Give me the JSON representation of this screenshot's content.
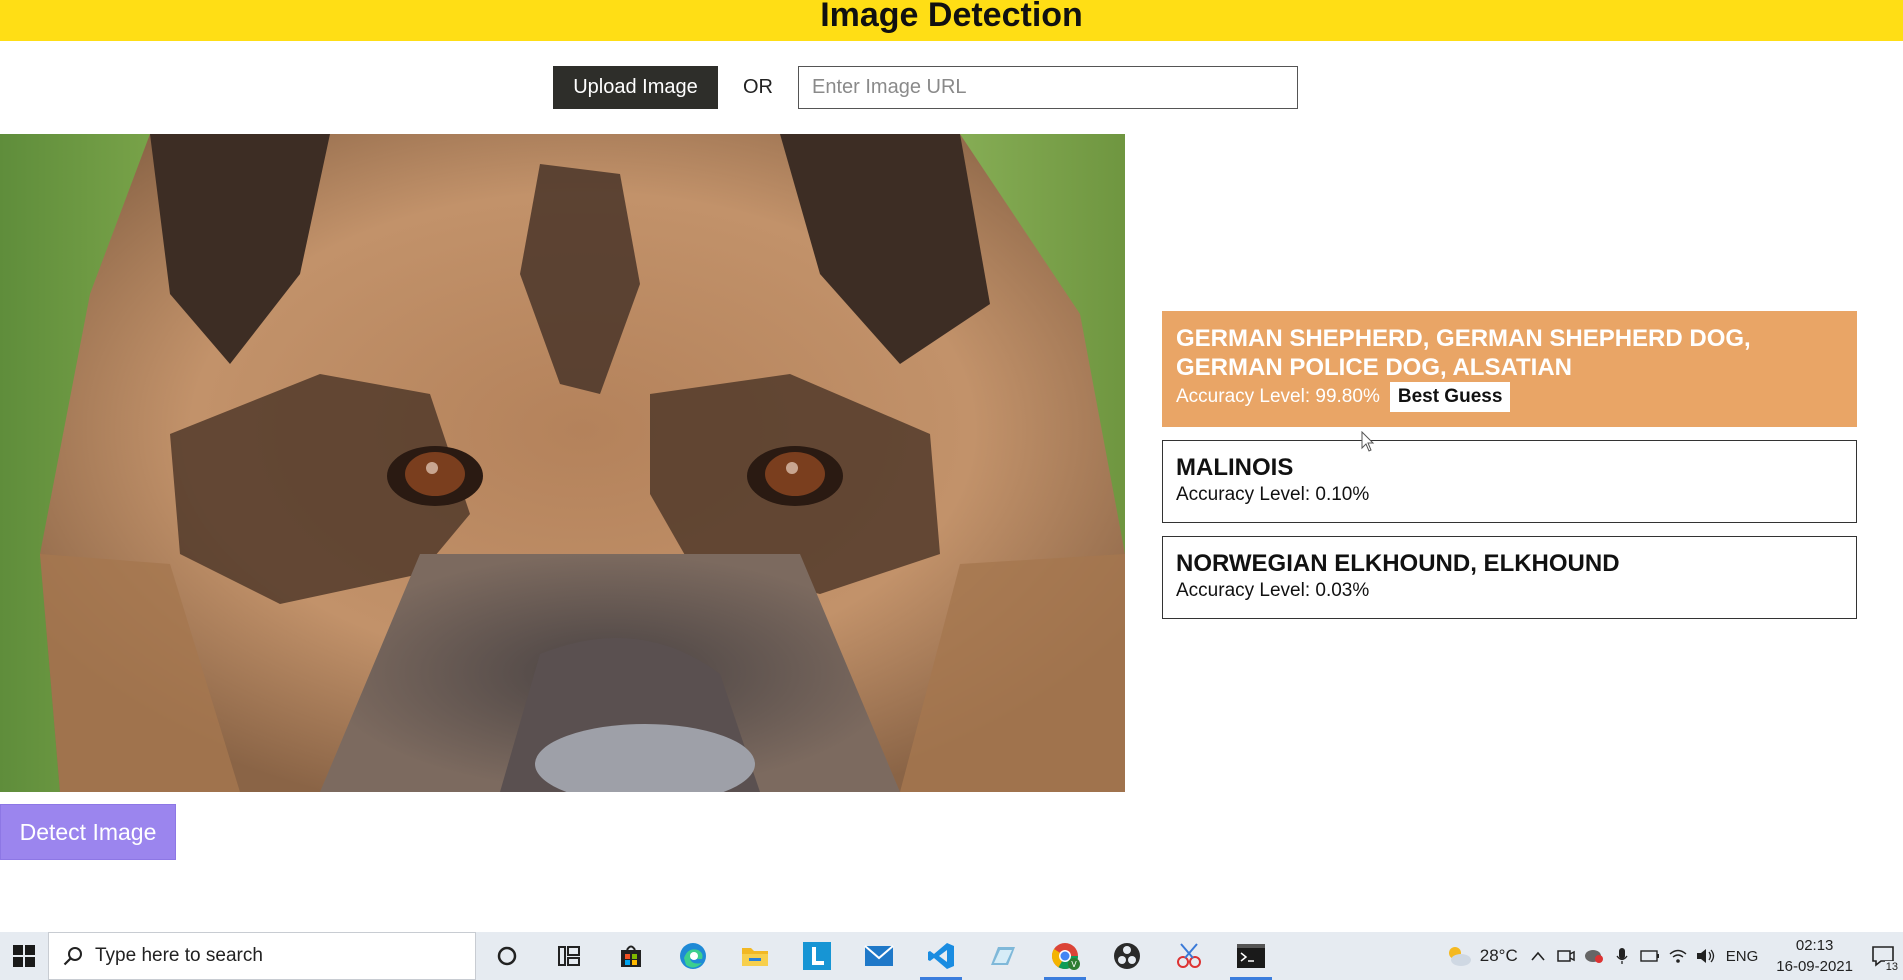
{
  "header": {
    "title": "Image Detection"
  },
  "controls": {
    "upload_label": "Upload Image",
    "or_label": "OR",
    "url_placeholder": "Enter Image URL",
    "url_value": ""
  },
  "detect_label": "Detect Image",
  "results": [
    {
      "name": "GERMAN SHEPHERD, GERMAN SHEPHERD DOG, GERMAN POLICE DOG, ALSATIAN",
      "accuracy": "Accuracy Level: 99.80%",
      "badge": "Best Guess"
    },
    {
      "name": "MALINOIS",
      "accuracy": "Accuracy Level: 0.10%"
    },
    {
      "name": "NORWEGIAN ELKHOUND, ELKHOUND",
      "accuracy": "Accuracy Level: 0.03%"
    }
  ],
  "colors": {
    "header_bg": "#ffde15",
    "best_bg": "#e9a566",
    "detect_bg": "#9b85ee",
    "upload_bg": "#2e2e2a"
  },
  "taskbar": {
    "search_placeholder": "Type here to search",
    "apps": [
      "cortana-icon",
      "task-view-icon",
      "store-icon",
      "edge-icon",
      "file-explorer-icon",
      "l-app-icon",
      "mail-icon",
      "vscode-icon",
      "app-icon",
      "chrome-icon",
      "obs-icon",
      "snip-icon",
      "terminal-icon"
    ],
    "weather": "28°C",
    "language": "ENG",
    "time": "02:13",
    "date": "16-09-2021",
    "notifications": "13"
  }
}
